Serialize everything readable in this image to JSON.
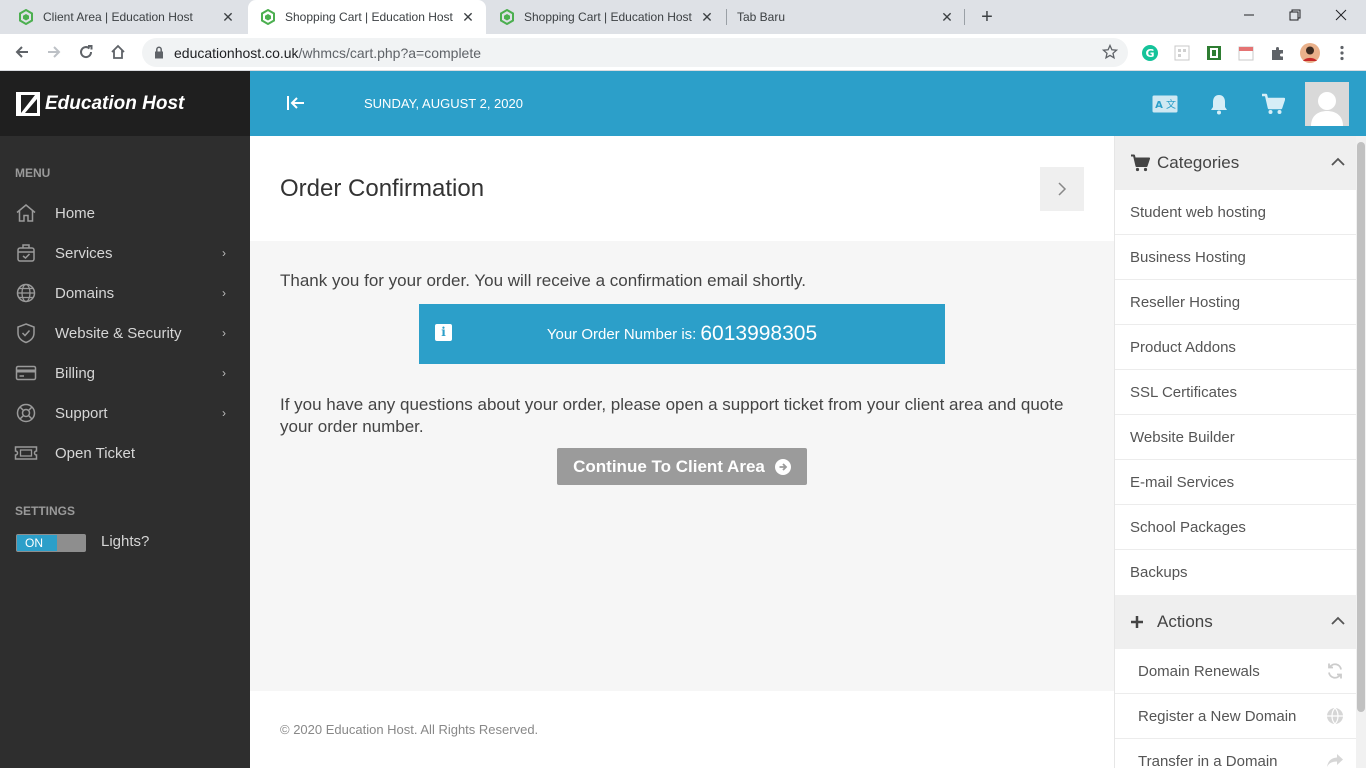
{
  "browser": {
    "tabs": [
      {
        "title": "Client Area | Education Host",
        "active": false
      },
      {
        "title": "Shopping Cart | Education Host",
        "active": true
      },
      {
        "title": "Shopping Cart | Education Host",
        "active": false
      },
      {
        "title": "Tab Baru",
        "active": false
      }
    ],
    "url_host": "educationhost.co.uk",
    "url_path": "/whmcs/cart.php?a=complete"
  },
  "sidebar": {
    "brand": "Education Host",
    "menu_label": "MENU",
    "items": [
      {
        "label": "Home",
        "icon": "home-icon",
        "has_children": false
      },
      {
        "label": "Services",
        "icon": "box-icon",
        "has_children": true
      },
      {
        "label": "Domains",
        "icon": "globe-icon",
        "has_children": true
      },
      {
        "label": "Website & Security",
        "icon": "shield-icon",
        "has_children": true
      },
      {
        "label": "Billing",
        "icon": "credit-card-icon",
        "has_children": true
      },
      {
        "label": "Support",
        "icon": "lifebuoy-icon",
        "has_children": true
      },
      {
        "label": "Open Ticket",
        "icon": "ticket-icon",
        "has_children": false
      }
    ],
    "settings_label": "SETTINGS",
    "toggle_state": "ON",
    "lights_label": "Lights?"
  },
  "header": {
    "date": "SUNDAY, AUGUST 2, 2020"
  },
  "main": {
    "title": "Order Confirmation",
    "thanks": "Thank you for your order. You will receive a confirmation email shortly.",
    "order_label": "Your Order Number is:",
    "order_number": "6013998305",
    "questions": "If you have any questions about your order, please open a support ticket from your client area and quote your order number.",
    "continue_label": "Continue To Client Area",
    "footer": "© 2020 Education Host. All Rights Reserved."
  },
  "right_panel": {
    "categories_title": "Categories",
    "categories": [
      "Student web hosting",
      "Business Hosting",
      "Reseller Hosting",
      "Product Addons",
      "SSL Certificates",
      "Website Builder",
      "E-mail Services",
      "School Packages",
      "Backups"
    ],
    "actions_title": "Actions",
    "actions": [
      {
        "label": "Domain Renewals",
        "icon": "refresh-icon"
      },
      {
        "label": "Register a New Domain",
        "icon": "globe-icon"
      },
      {
        "label": "Transfer in a Domain",
        "icon": "share-arrow-icon"
      }
    ]
  },
  "colors": {
    "accent": "#2c9fc9",
    "sidebar_bg": "#2e2e2e",
    "brand_bg": "#1f1f1f",
    "button_gray": "#9b9b9b"
  }
}
